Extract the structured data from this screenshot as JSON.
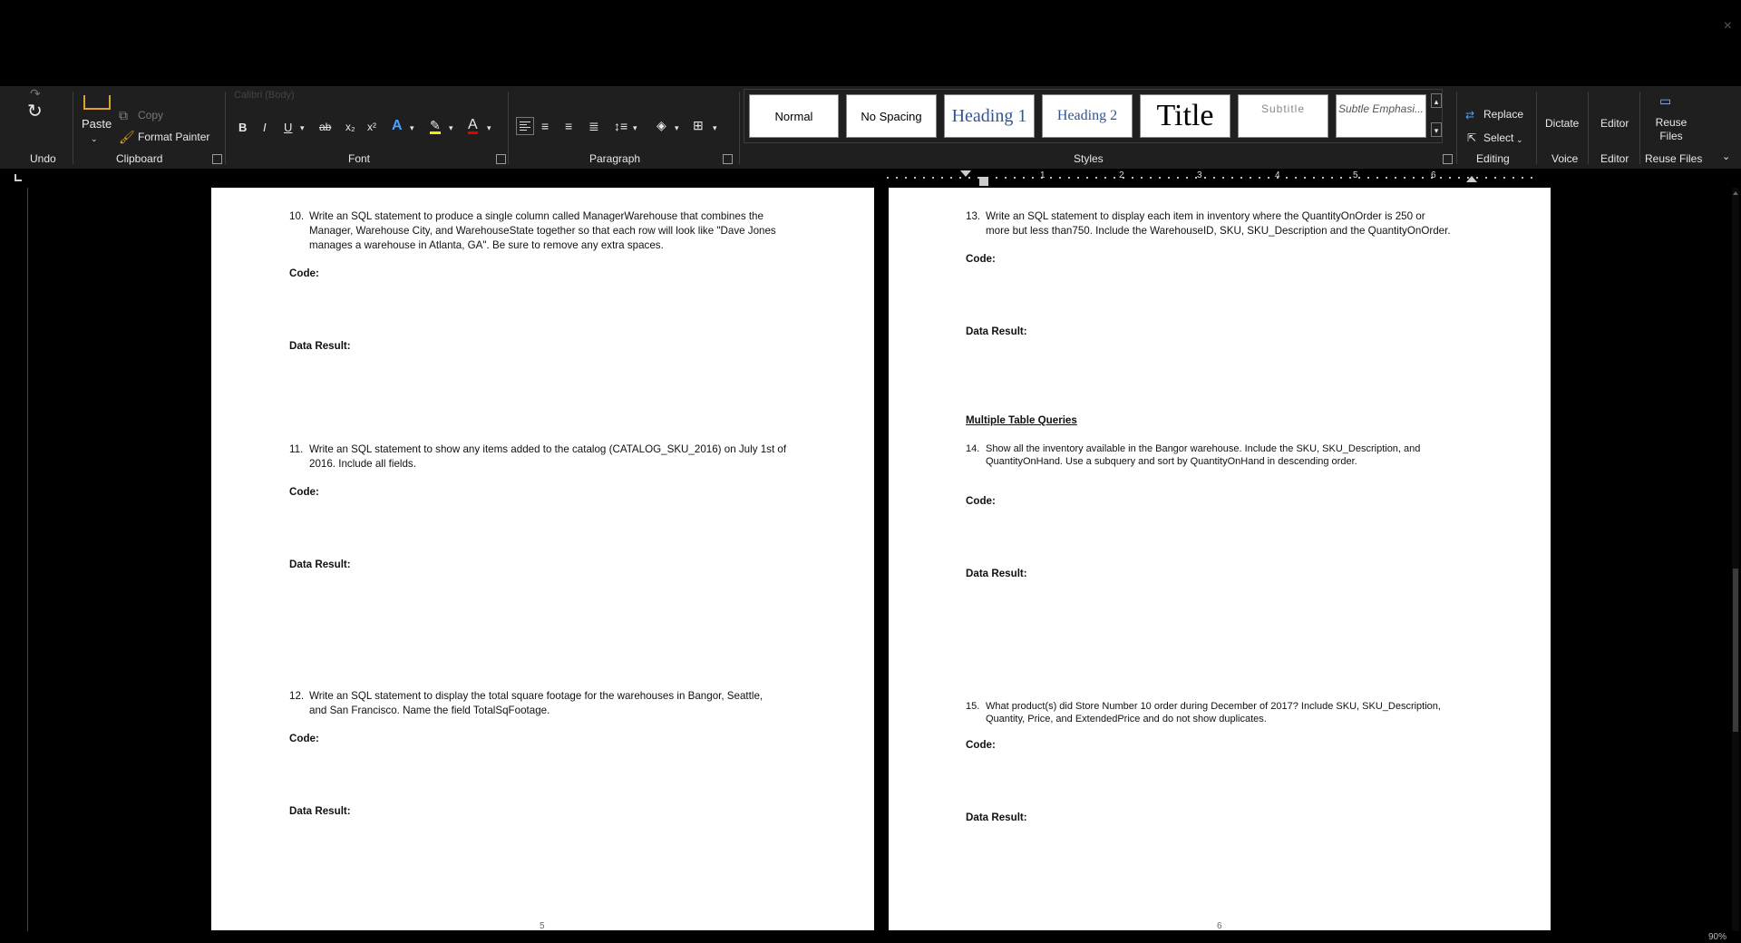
{
  "window": {
    "close_glyph": "×"
  },
  "ribbon": {
    "undo": {
      "group": "Undo"
    },
    "clipboard": {
      "paste": "Paste",
      "copy": "Copy",
      "format_painter": "Format Painter",
      "group": "Clipboard"
    },
    "font": {
      "font_name": "Calibri (Body)",
      "bold": "B",
      "italic": "I",
      "underline": "U",
      "strike": "ab",
      "subscript": "x₂",
      "superscript": "x²",
      "group": "Font"
    },
    "paragraph": {
      "group": "Paragraph"
    },
    "styles": {
      "group": "Styles",
      "items": [
        "Normal",
        "No Spacing",
        "Heading 1",
        "Heading 2",
        "Title",
        "Subtitle",
        "Subtle Emphasi..."
      ]
    },
    "editing": {
      "replace": "Replace",
      "select": "Select",
      "group": "Editing"
    },
    "voice": {
      "dictate": "Dictate",
      "group": "Voice"
    },
    "editor": {
      "label": "Editor",
      "group": "Editor"
    },
    "reuse": {
      "label": "Reuse Files",
      "group": "Reuse Files"
    }
  },
  "ruler": {
    "marks": [
      "1",
      "2",
      "3",
      "4",
      "5",
      "6"
    ]
  },
  "left_page": {
    "page_number": "5",
    "q10": {
      "num": "10.",
      "line1": "Write an SQL statement to produce a single column called ManagerWarehouse that combines the",
      "line2": "Manager, Warehouse City, and WarehouseState together so that each row will look like \"Dave Jones",
      "line3": "manages a warehouse in Atlanta, GA\". Be sure to remove any extra spaces."
    },
    "q11": {
      "num": "11.",
      "line1": "Write an SQL statement to show any items added to the catalog (CATALOG_SKU_2016) on July 1st of",
      "line2": "2016. Include all fields."
    },
    "q12": {
      "num": "12.",
      "line1": "Write an SQL statement to display the total square footage for the warehouses in Bangor, Seattle,",
      "line2": "and San Francisco. Name the field TotalSqFootage."
    },
    "code_label": "Code:",
    "result_label": "Data Result:"
  },
  "right_page": {
    "page_number": "6",
    "q13": {
      "num": "13.",
      "line1": "Write an SQL statement to display each item in inventory where the QuantityOnOrder is 250 or",
      "line2": "more but less than750. Include the WarehouseID, SKU, SKU_Description and the QuantityOnOrder."
    },
    "section_heading": "Multiple Table Queries",
    "q14": {
      "num": "14.",
      "line1": "Show all the inventory available in the Bangor warehouse. Include the SKU, SKU_Description, and",
      "line2": "QuantityOnHand. Use a subquery and sort by QuantityOnHand in descending order."
    },
    "q15": {
      "num": "15.",
      "line1": "What product(s) did Store Number 10 order during December of 2017? Include SKU, SKU_Description,",
      "line2": "Quantity, Price, and ExtendedPrice and do not show duplicates."
    },
    "code_label": "Code:",
    "result_label": "Data Result:"
  },
  "status": {
    "zoom": "90%"
  }
}
